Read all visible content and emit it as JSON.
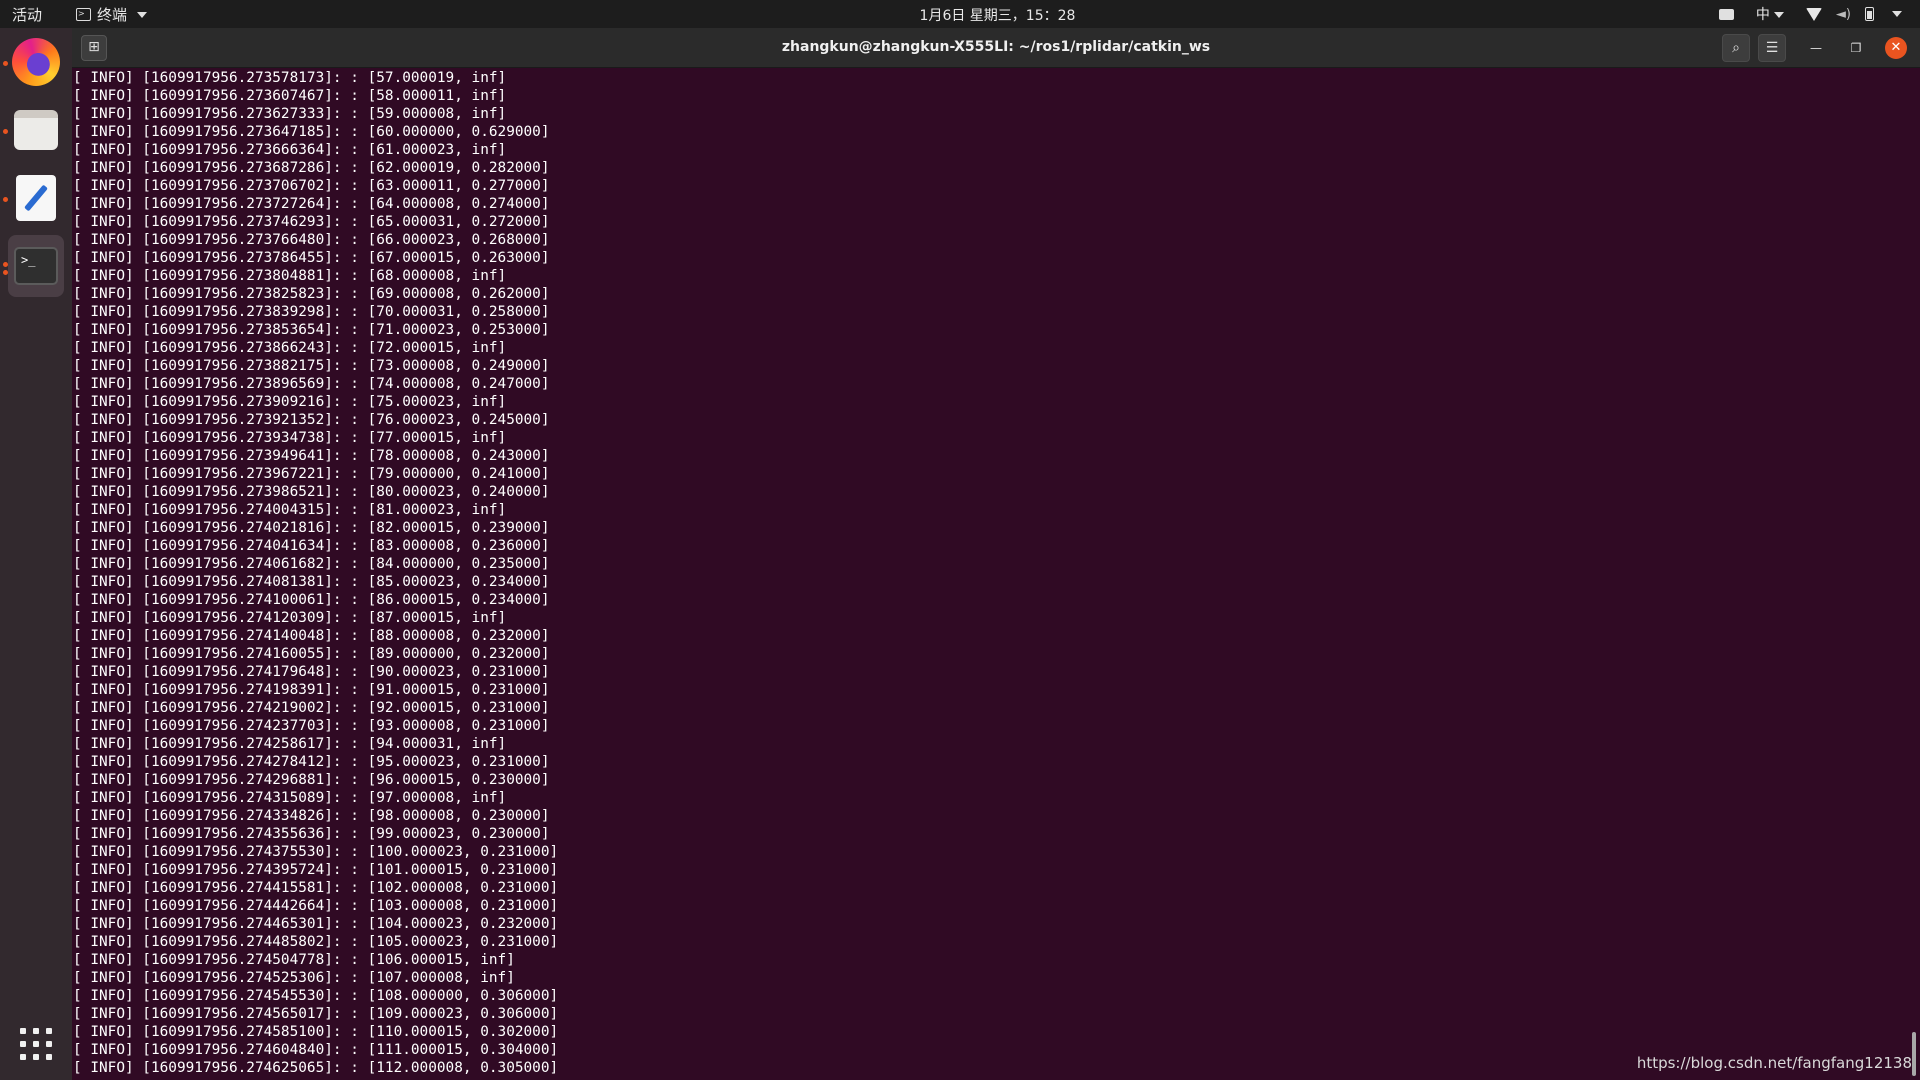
{
  "topbar": {
    "activities": "活动",
    "app_menu": "终端",
    "clock": "1月6日 星期三，15：28",
    "input_method": "中"
  },
  "dock": {
    "items": [
      "firefox",
      "files",
      "text-editor",
      "terminal"
    ],
    "apps_grid": "show-applications"
  },
  "window": {
    "title": "zhangkun@zhangkun-X555LI: ~/ros1/rplidar/catkin_ws",
    "buttons": [
      "search",
      "menu",
      "minimize",
      "restore",
      "close"
    ]
  },
  "terminal": {
    "lines": [
      "[ INFO] [1609917956.273578173]: : [57.000019, inf]",
      "[ INFO] [1609917956.273607467]: : [58.000011, inf]",
      "[ INFO] [1609917956.273627333]: : [59.000008, inf]",
      "[ INFO] [1609917956.273647185]: : [60.000000, 0.629000]",
      "[ INFO] [1609917956.273666364]: : [61.000023, inf]",
      "[ INFO] [1609917956.273687286]: : [62.000019, 0.282000]",
      "[ INFO] [1609917956.273706702]: : [63.000011, 0.277000]",
      "[ INFO] [1609917956.273727264]: : [64.000008, 0.274000]",
      "[ INFO] [1609917956.273746293]: : [65.000031, 0.272000]",
      "[ INFO] [1609917956.273766480]: : [66.000023, 0.268000]",
      "[ INFO] [1609917956.273786455]: : [67.000015, 0.263000]",
      "[ INFO] [1609917956.273804881]: : [68.000008, inf]",
      "[ INFO] [1609917956.273825823]: : [69.000008, 0.262000]",
      "[ INFO] [1609917956.273839298]: : [70.000031, 0.258000]",
      "[ INFO] [1609917956.273853654]: : [71.000023, 0.253000]",
      "[ INFO] [1609917956.273866243]: : [72.000015, inf]",
      "[ INFO] [1609917956.273882175]: : [73.000008, 0.249000]",
      "[ INFO] [1609917956.273896569]: : [74.000008, 0.247000]",
      "[ INFO] [1609917956.273909216]: : [75.000023, inf]",
      "[ INFO] [1609917956.273921352]: : [76.000023, 0.245000]",
      "[ INFO] [1609917956.273934738]: : [77.000015, inf]",
      "[ INFO] [1609917956.273949641]: : [78.000008, 0.243000]",
      "[ INFO] [1609917956.273967221]: : [79.000000, 0.241000]",
      "[ INFO] [1609917956.273986521]: : [80.000023, 0.240000]",
      "[ INFO] [1609917956.274004315]: : [81.000023, inf]",
      "[ INFO] [1609917956.274021816]: : [82.000015, 0.239000]",
      "[ INFO] [1609917956.274041634]: : [83.000008, 0.236000]",
      "[ INFO] [1609917956.274061682]: : [84.000000, 0.235000]",
      "[ INFO] [1609917956.274081381]: : [85.000023, 0.234000]",
      "[ INFO] [1609917956.274100061]: : [86.000015, 0.234000]",
      "[ INFO] [1609917956.274120309]: : [87.000015, inf]",
      "[ INFO] [1609917956.274140048]: : [88.000008, 0.232000]",
      "[ INFO] [1609917956.274160055]: : [89.000000, 0.232000]",
      "[ INFO] [1609917956.274179648]: : [90.000023, 0.231000]",
      "[ INFO] [1609917956.274198391]: : [91.000015, 0.231000]",
      "[ INFO] [1609917956.274219002]: : [92.000015, 0.231000]",
      "[ INFO] [1609917956.274237703]: : [93.000008, 0.231000]",
      "[ INFO] [1609917956.274258617]: : [94.000031, inf]",
      "[ INFO] [1609917956.274278412]: : [95.000023, 0.231000]",
      "[ INFO] [1609917956.274296881]: : [96.000015, 0.230000]",
      "[ INFO] [1609917956.274315089]: : [97.000008, inf]",
      "[ INFO] [1609917956.274334826]: : [98.000008, 0.230000]",
      "[ INFO] [1609917956.274355636]: : [99.000023, 0.230000]",
      "[ INFO] [1609917956.274375530]: : [100.000023, 0.231000]",
      "[ INFO] [1609917956.274395724]: : [101.000015, 0.231000]",
      "[ INFO] [1609917956.274415581]: : [102.000008, 0.231000]",
      "[ INFO] [1609917956.274442664]: : [103.000008, 0.231000]",
      "[ INFO] [1609917956.274465301]: : [104.000023, 0.232000]",
      "[ INFO] [1609917956.274485802]: : [105.000023, 0.231000]",
      "[ INFO] [1609917956.274504778]: : [106.000015, inf]",
      "[ INFO] [1609917956.274525306]: : [107.000008, inf]",
      "[ INFO] [1609917956.274545530]: : [108.000000, 0.306000]",
      "[ INFO] [1609917956.274565017]: : [109.000023, 0.306000]",
      "[ INFO] [1609917956.274585100]: : [110.000015, 0.302000]",
      "[ INFO] [1609917956.274604840]: : [111.000015, 0.304000]",
      "[ INFO] [1609917956.274625065]: : [112.000008, 0.305000]"
    ],
    "watermark": "https://blog.csdn.net/fangfang12138"
  },
  "colors": {
    "terminal_bg": "#300a24",
    "accent": "#e95420",
    "topbar_bg": "#1d1d1d"
  }
}
